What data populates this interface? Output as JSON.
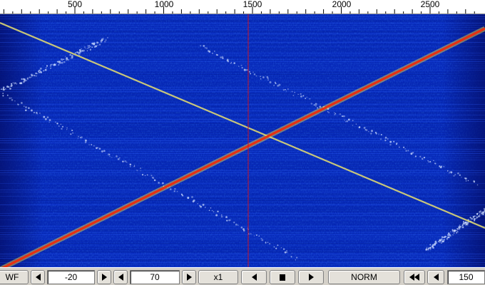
{
  "scale": {
    "ticks": [
      500,
      1000,
      1500,
      2000,
      2500
    ],
    "labels": [
      "500",
      "1000",
      "1500",
      "2000",
      "2500"
    ]
  },
  "waterfall": {
    "marker_frequency": 1500,
    "colors": {
      "background": "#0628b8",
      "marker": "#c8142a",
      "strong_trace": "#e83010",
      "weak_trace": "#e8e070",
      "noise": "#6fa8ff"
    }
  },
  "toolbar": {
    "mode_label": "WF",
    "ref_level_value": "-20",
    "range_value": "70",
    "zoom_label": "x1",
    "speed_label": "NORM",
    "step_value": "150"
  }
}
